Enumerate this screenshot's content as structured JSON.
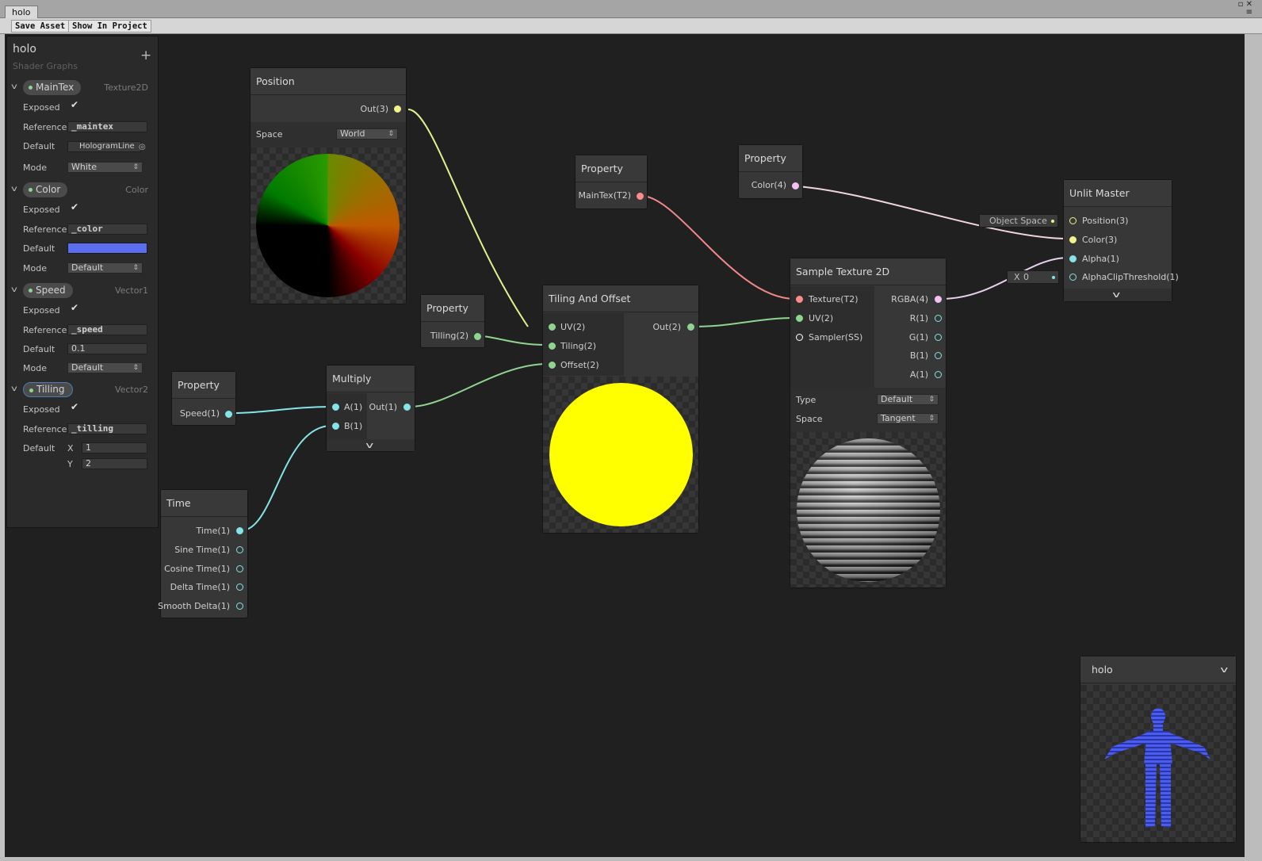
{
  "window": {
    "tab_title": "holo",
    "controls": "▫ ✕",
    "menu_glyph": "≡"
  },
  "toolbar": {
    "save_asset": "Save Asset",
    "show_in_project": "Show In Project"
  },
  "blackboard": {
    "title": "holo",
    "subtitle": "Shader Graphs",
    "add_glyph": "+",
    "row_labels": {
      "exposed": "Exposed",
      "reference": "Reference",
      "default": "Default",
      "mode": "Mode"
    },
    "check_glyph": "✔",
    "properties": [
      {
        "name": "MainTex",
        "type": "Texture2D",
        "reference": "_maintex",
        "default": "HologramLine",
        "mode": "White"
      },
      {
        "name": "Color",
        "type": "Color",
        "reference": "_color",
        "default_color": "#5b6ef0",
        "mode": "Default"
      },
      {
        "name": "Speed",
        "type": "Vector1",
        "reference": "_speed",
        "default": "0.1",
        "mode": "Default"
      },
      {
        "name": "Tilling",
        "type": "Vector2",
        "reference": "_tilling",
        "default_x_label": "X",
        "default_x": "1",
        "default_y_label": "Y",
        "default_y": "2"
      }
    ]
  },
  "nodes": {
    "position": {
      "title": "Position",
      "out": "Out(3)",
      "space_label": "Space",
      "space_value": "World"
    },
    "prop_maintex": {
      "title": "Property",
      "out": "MainTex(T2)"
    },
    "prop_color": {
      "title": "Property",
      "out": "Color(4)"
    },
    "prop_tilling": {
      "title": "Property",
      "out": "Tilling(2)"
    },
    "prop_speed": {
      "title": "Property",
      "out": "Speed(1)"
    },
    "multiply": {
      "title": "Multiply",
      "in_a": "A(1)",
      "in_b": "B(1)",
      "out": "Out(1)"
    },
    "time": {
      "title": "Time",
      "outputs": [
        "Time(1)",
        "Sine Time(1)",
        "Cosine Time(1)",
        "Delta Time(1)",
        "Smooth Delta(1)"
      ]
    },
    "tiling": {
      "title": "Tiling And Offset",
      "in_uv": "UV(2)",
      "in_tiling": "Tiling(2)",
      "in_offset": "Offset(2)",
      "out": "Out(2)"
    },
    "sample": {
      "title": "Sample Texture 2D",
      "inputs": [
        "Texture(T2)",
        "UV(2)",
        "Sampler(SS)"
      ],
      "outputs": [
        "RGBA(4)",
        "R(1)",
        "G(1)",
        "B(1)",
        "A(1)"
      ],
      "type_label": "Type",
      "type_value": "Default",
      "space_label": "Space",
      "space_value": "Tangent"
    },
    "master": {
      "title": "Unlit Master",
      "inputs": [
        "Position(3)",
        "Color(3)",
        "Alpha(1)",
        "AlphaClipThreshold(1)"
      ],
      "object_space": "Object Space",
      "alpha_clip_x_label": "X",
      "alpha_clip_x": "0"
    },
    "preview": {
      "title": "holo"
    }
  },
  "colors": {
    "vector3": "#f1f48a",
    "vector2": "#8fd58f",
    "vector1": "#84e4e7",
    "vector4": "#f5c1f3",
    "texture": "#ff8b8b",
    "sampler": "#ffffff",
    "accent": "#4a7fb4"
  }
}
